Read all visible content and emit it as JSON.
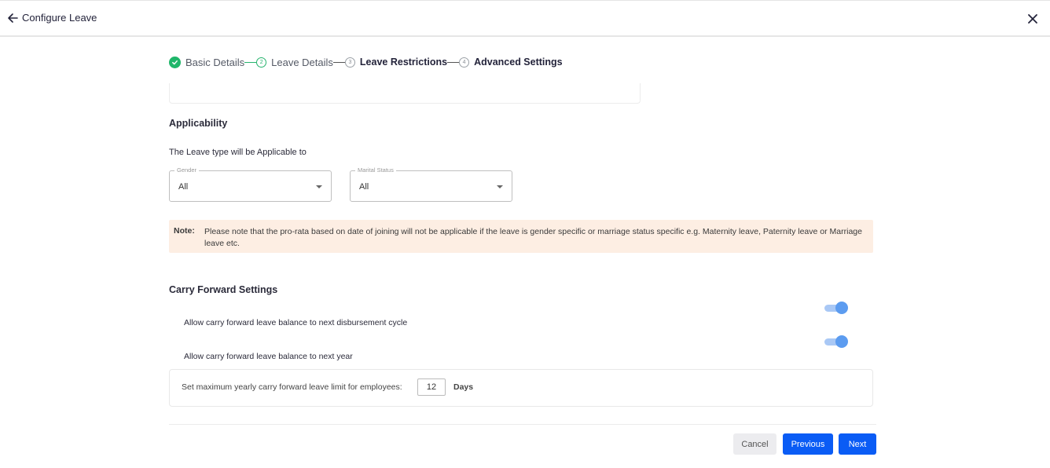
{
  "header": {
    "title": "Configure Leave",
    "back_icon": "arrow-left-icon",
    "close_icon": "close-icon"
  },
  "stepper": {
    "steps": [
      {
        "number": "1",
        "label": "Basic Details",
        "status": "completed"
      },
      {
        "number": "2",
        "label": "Leave Details",
        "status": "active"
      },
      {
        "number": "3",
        "label": "Leave Restrictions",
        "status": "pending"
      },
      {
        "number": "4",
        "label": "Advanced Settings",
        "status": "pending"
      }
    ]
  },
  "applicability": {
    "title": "Applicability",
    "subtitle": "The Leave type will be Applicable to",
    "gender": {
      "label": "Gender",
      "value": "All"
    },
    "marital_status": {
      "label": "Marital Status",
      "value": "All"
    }
  },
  "note": {
    "label": "Note:",
    "text": "Please note that the pro-rata based on date of joining will not be applicable if the leave is gender specific or marriage status specific e.g. Maternity leave, Paternity leave or Marriage leave etc."
  },
  "carry_forward": {
    "title": "Carry Forward Settings",
    "options": [
      {
        "label": "Allow carry forward leave balance to next disbursement cycle",
        "enabled": true
      },
      {
        "label": "Allow carry forward leave balance to next year",
        "enabled": true
      }
    ],
    "limit": {
      "label": "Set maximum yearly carry forward leave limit for employees:",
      "value": "12",
      "unit": "Days"
    }
  },
  "footer": {
    "cancel_label": "Cancel",
    "previous_label": "Previous",
    "next_label": "Next"
  },
  "colors": {
    "primary": "#0a5cf5",
    "success": "#1fb66a",
    "note_bg": "#fdeee3",
    "toggle_on": "#5c9cf0"
  }
}
